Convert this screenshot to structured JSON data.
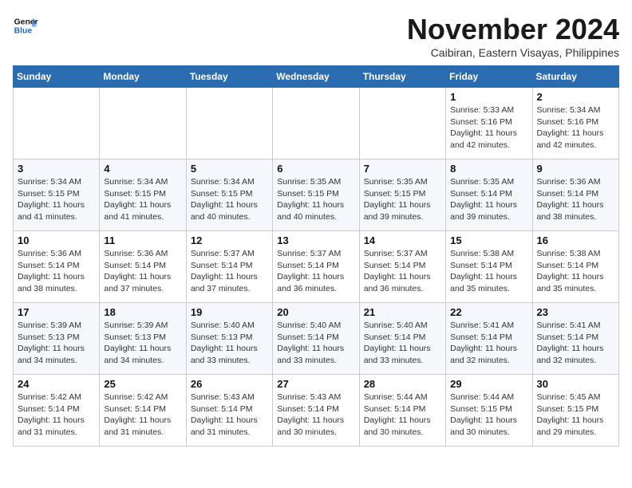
{
  "header": {
    "logo_line1": "General",
    "logo_line2": "Blue",
    "month_title": "November 2024",
    "location": "Caibiran, Eastern Visayas, Philippines"
  },
  "weekdays": [
    "Sunday",
    "Monday",
    "Tuesday",
    "Wednesday",
    "Thursday",
    "Friday",
    "Saturday"
  ],
  "weeks": [
    [
      {
        "day": "",
        "info": ""
      },
      {
        "day": "",
        "info": ""
      },
      {
        "day": "",
        "info": ""
      },
      {
        "day": "",
        "info": ""
      },
      {
        "day": "",
        "info": ""
      },
      {
        "day": "1",
        "info": "Sunrise: 5:33 AM\nSunset: 5:16 PM\nDaylight: 11 hours\nand 42 minutes."
      },
      {
        "day": "2",
        "info": "Sunrise: 5:34 AM\nSunset: 5:16 PM\nDaylight: 11 hours\nand 42 minutes."
      }
    ],
    [
      {
        "day": "3",
        "info": "Sunrise: 5:34 AM\nSunset: 5:15 PM\nDaylight: 11 hours\nand 41 minutes."
      },
      {
        "day": "4",
        "info": "Sunrise: 5:34 AM\nSunset: 5:15 PM\nDaylight: 11 hours\nand 41 minutes."
      },
      {
        "day": "5",
        "info": "Sunrise: 5:34 AM\nSunset: 5:15 PM\nDaylight: 11 hours\nand 40 minutes."
      },
      {
        "day": "6",
        "info": "Sunrise: 5:35 AM\nSunset: 5:15 PM\nDaylight: 11 hours\nand 40 minutes."
      },
      {
        "day": "7",
        "info": "Sunrise: 5:35 AM\nSunset: 5:15 PM\nDaylight: 11 hours\nand 39 minutes."
      },
      {
        "day": "8",
        "info": "Sunrise: 5:35 AM\nSunset: 5:14 PM\nDaylight: 11 hours\nand 39 minutes."
      },
      {
        "day": "9",
        "info": "Sunrise: 5:36 AM\nSunset: 5:14 PM\nDaylight: 11 hours\nand 38 minutes."
      }
    ],
    [
      {
        "day": "10",
        "info": "Sunrise: 5:36 AM\nSunset: 5:14 PM\nDaylight: 11 hours\nand 38 minutes."
      },
      {
        "day": "11",
        "info": "Sunrise: 5:36 AM\nSunset: 5:14 PM\nDaylight: 11 hours\nand 37 minutes."
      },
      {
        "day": "12",
        "info": "Sunrise: 5:37 AM\nSunset: 5:14 PM\nDaylight: 11 hours\nand 37 minutes."
      },
      {
        "day": "13",
        "info": "Sunrise: 5:37 AM\nSunset: 5:14 PM\nDaylight: 11 hours\nand 36 minutes."
      },
      {
        "day": "14",
        "info": "Sunrise: 5:37 AM\nSunset: 5:14 PM\nDaylight: 11 hours\nand 36 minutes."
      },
      {
        "day": "15",
        "info": "Sunrise: 5:38 AM\nSunset: 5:14 PM\nDaylight: 11 hours\nand 35 minutes."
      },
      {
        "day": "16",
        "info": "Sunrise: 5:38 AM\nSunset: 5:14 PM\nDaylight: 11 hours\nand 35 minutes."
      }
    ],
    [
      {
        "day": "17",
        "info": "Sunrise: 5:39 AM\nSunset: 5:13 PM\nDaylight: 11 hours\nand 34 minutes."
      },
      {
        "day": "18",
        "info": "Sunrise: 5:39 AM\nSunset: 5:13 PM\nDaylight: 11 hours\nand 34 minutes."
      },
      {
        "day": "19",
        "info": "Sunrise: 5:40 AM\nSunset: 5:13 PM\nDaylight: 11 hours\nand 33 minutes."
      },
      {
        "day": "20",
        "info": "Sunrise: 5:40 AM\nSunset: 5:14 PM\nDaylight: 11 hours\nand 33 minutes."
      },
      {
        "day": "21",
        "info": "Sunrise: 5:40 AM\nSunset: 5:14 PM\nDaylight: 11 hours\nand 33 minutes."
      },
      {
        "day": "22",
        "info": "Sunrise: 5:41 AM\nSunset: 5:14 PM\nDaylight: 11 hours\nand 32 minutes."
      },
      {
        "day": "23",
        "info": "Sunrise: 5:41 AM\nSunset: 5:14 PM\nDaylight: 11 hours\nand 32 minutes."
      }
    ],
    [
      {
        "day": "24",
        "info": "Sunrise: 5:42 AM\nSunset: 5:14 PM\nDaylight: 11 hours\nand 31 minutes."
      },
      {
        "day": "25",
        "info": "Sunrise: 5:42 AM\nSunset: 5:14 PM\nDaylight: 11 hours\nand 31 minutes."
      },
      {
        "day": "26",
        "info": "Sunrise: 5:43 AM\nSunset: 5:14 PM\nDaylight: 11 hours\nand 31 minutes."
      },
      {
        "day": "27",
        "info": "Sunrise: 5:43 AM\nSunset: 5:14 PM\nDaylight: 11 hours\nand 30 minutes."
      },
      {
        "day": "28",
        "info": "Sunrise: 5:44 AM\nSunset: 5:14 PM\nDaylight: 11 hours\nand 30 minutes."
      },
      {
        "day": "29",
        "info": "Sunrise: 5:44 AM\nSunset: 5:15 PM\nDaylight: 11 hours\nand 30 minutes."
      },
      {
        "day": "30",
        "info": "Sunrise: 5:45 AM\nSunset: 5:15 PM\nDaylight: 11 hours\nand 29 minutes."
      }
    ]
  ]
}
